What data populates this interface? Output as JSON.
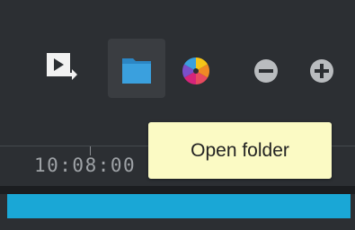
{
  "toolbar": {
    "export_icon": "export-video-icon",
    "folder_icon": "folder-icon",
    "color_icon": "color-wheel-icon",
    "zoom_out_icon": "zoom-out-icon",
    "zoom_in_icon": "zoom-in-icon"
  },
  "timeline": {
    "timecode": "10:08:00"
  },
  "tooltip": {
    "text": "Open folder"
  },
  "colors": {
    "background": "#2c2f33",
    "clip": "#1aa7d6",
    "folder": "#3aa0de",
    "tooltip_bg": "#fbfac4"
  }
}
